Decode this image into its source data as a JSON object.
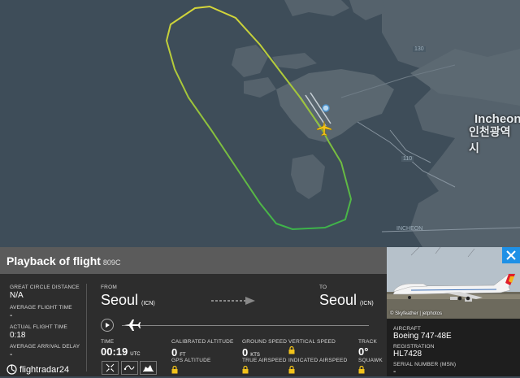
{
  "map": {
    "city_en": "Incheon",
    "city_ko": "인천광역시",
    "route_label_1": "INCHEON",
    "route_badge_1": "110",
    "route_badge_2": "130"
  },
  "panel": {
    "title": "Playback of flight",
    "flight_number": "809C",
    "stats": {
      "great_circle_label": "GREAT CIRCLE DISTANCE",
      "great_circle_value": "N/A",
      "avg_flight_time_label": "AVERAGE FLIGHT TIME",
      "avg_flight_time_value": "-",
      "actual_flight_time_label": "ACTUAL FLIGHT TIME",
      "actual_flight_time_value": "0:18",
      "avg_arrival_delay_label": "AVERAGE ARRIVAL DELAY",
      "avg_arrival_delay_value": "-"
    },
    "from_label": "FROM",
    "from_city": "Seoul",
    "from_code": "(ICN)",
    "to_label": "TO",
    "to_city": "Seoul",
    "to_code": "(ICN)",
    "time_label": "TIME",
    "time_value": "00:19",
    "time_unit": "UTC",
    "cal_alt_label": "CALIBRATED ALTITUDE",
    "cal_alt_value": "0",
    "cal_alt_unit": "FT",
    "gps_alt_label": "GPS ALTITUDE",
    "ground_speed_label": "GROUND SPEED",
    "ground_speed_value": "0",
    "ground_speed_unit": "KTS",
    "true_airspeed_label": "TRUE AIRSPEED",
    "vertical_speed_label": "VERTICAL SPEED",
    "indicated_airspeed_label": "INDICATED AIRSPEED",
    "track_label": "TRACK",
    "track_value": "0°",
    "squawk_label": "SQUAWK",
    "logo_text": "flightradar24",
    "progress": 0.0
  },
  "aircraft": {
    "photo_credit": "© Skyfeather | jetphotos",
    "aircraft_label": "AIRCRAFT",
    "aircraft_value": "Boeing 747-48E",
    "registration_label": "REGISTRATION",
    "registration_value": "HL7428",
    "serial_label": "SERIAL NUMBER (MSN)",
    "serial_value": "-"
  },
  "colors": {
    "header_bg": "#5b5b5b",
    "panel_bg": "#2d2d2d",
    "accent_yellow": "#f2c31a",
    "accent_blue": "#1e90e6",
    "track_green": "#3cb34a",
    "track_yellow": "#d6d63a"
  }
}
